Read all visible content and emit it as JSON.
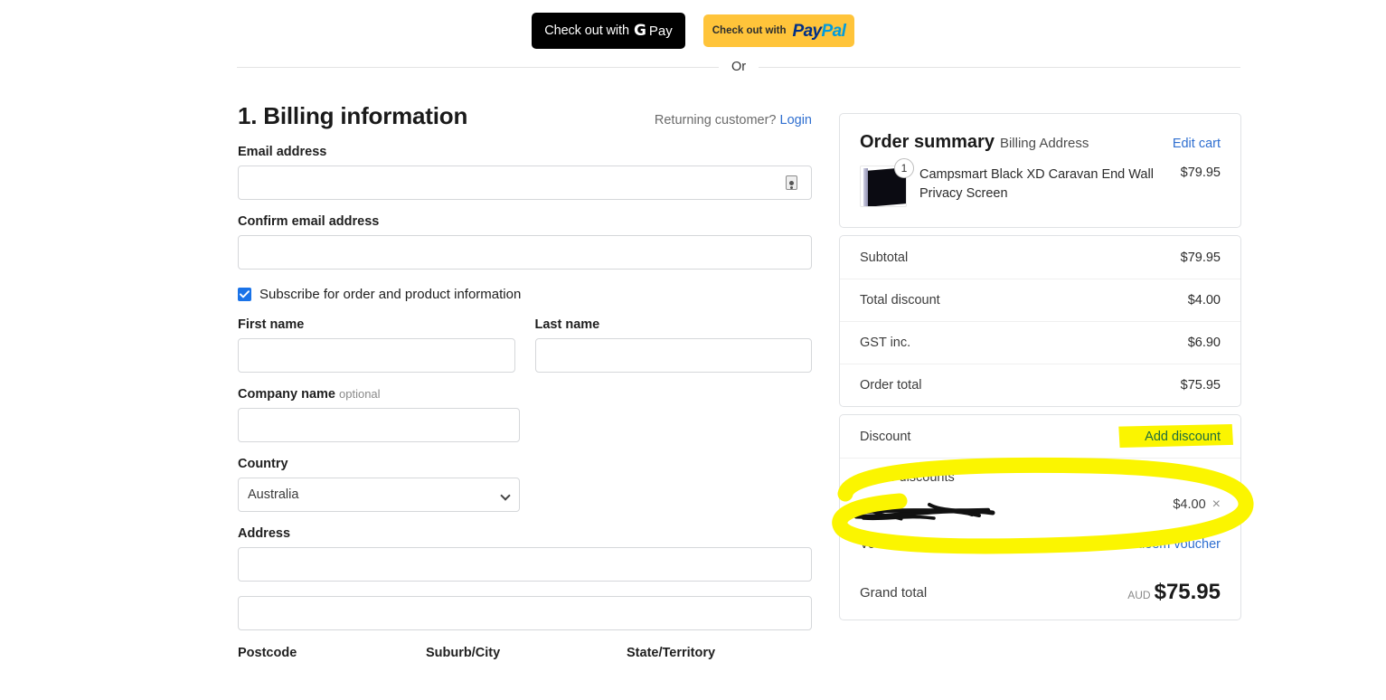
{
  "express": {
    "gpay": {
      "label": "Check out with",
      "brand_g": "G",
      "brand_pay": "Pay"
    },
    "paypal": {
      "label": "Check out with",
      "brand_pay": "Pay",
      "brand_pal": "Pal"
    },
    "divider_text": "Or"
  },
  "billing": {
    "section_title": "1. Billing information",
    "returning_text": "Returning customer?",
    "login_label": "Login",
    "email_label": "Email address",
    "email_value": "",
    "confirm_email_label": "Confirm email address",
    "confirm_email_value": "",
    "subscribe_label": "Subscribe for order and product information",
    "subscribe_checked": true,
    "first_name_label": "First name",
    "first_name_value": "",
    "last_name_label": "Last name",
    "last_name_value": "",
    "company_label": "Company name",
    "company_optional": "optional",
    "company_value": "",
    "country_label": "Country",
    "country_value": "Australia",
    "country_options": [
      "Australia"
    ],
    "address_label": "Address",
    "address_line1_value": "",
    "address_line2_value": "",
    "postcode_label": "Postcode",
    "suburb_label": "Suburb/City",
    "state_label": "State/Territory"
  },
  "order_summary": {
    "title": "Order summary",
    "subtitle": "Billing Address",
    "edit_cart_label": "Edit cart",
    "items": [
      {
        "name": "Campsmart Black XD Caravan End Wall Privacy Screen",
        "price": "$79.95",
        "qty": "1"
      }
    ],
    "totals": [
      {
        "label": "Subtotal",
        "value": "$79.95"
      },
      {
        "label": "Total discount",
        "value": "$4.00"
      },
      {
        "label": "GST inc.",
        "value": "$6.90"
      },
      {
        "label": "Order total",
        "value": "$75.95"
      }
    ],
    "discount": {
      "label": "Discount",
      "add_label": "Add discount",
      "active_title": "Active discounts",
      "active_code": "",
      "active_amount": "$4.00",
      "remove_icon": "×"
    },
    "voucher": {
      "label": "Voucher",
      "redeem_label": "Redeem voucher"
    },
    "grand_total": {
      "label": "Grand total",
      "currency": "AUD",
      "amount": "$75.95"
    }
  },
  "colors": {
    "link": "#2f6fd0",
    "highlight": "#fbf500",
    "gpay_bg": "#000000",
    "paypal_bg": "#ffc43a",
    "checkbox": "#1a73e8"
  }
}
